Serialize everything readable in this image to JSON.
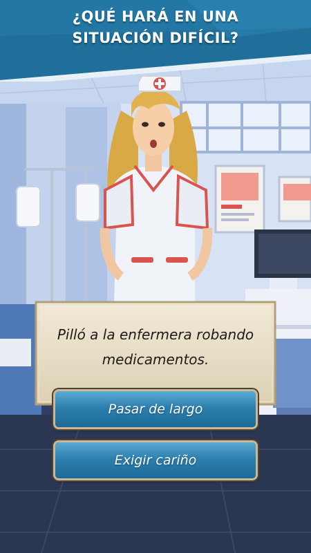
{
  "header": {
    "title_line1": "¿QUÉ HARÁ EN UNA",
    "title_line2": "SITUACIÓN DIFÍCIL?"
  },
  "dialog": {
    "text_line1": "Pilló a la enfermera robando",
    "text_line2": "medicamentos."
  },
  "choices": [
    {
      "label": "Pasar de largo"
    },
    {
      "label": "Exigir cariño"
    }
  ],
  "colors": {
    "header_bg": "#1f6f9a",
    "button": "#2c7fae",
    "paper": "#ece3cd"
  }
}
